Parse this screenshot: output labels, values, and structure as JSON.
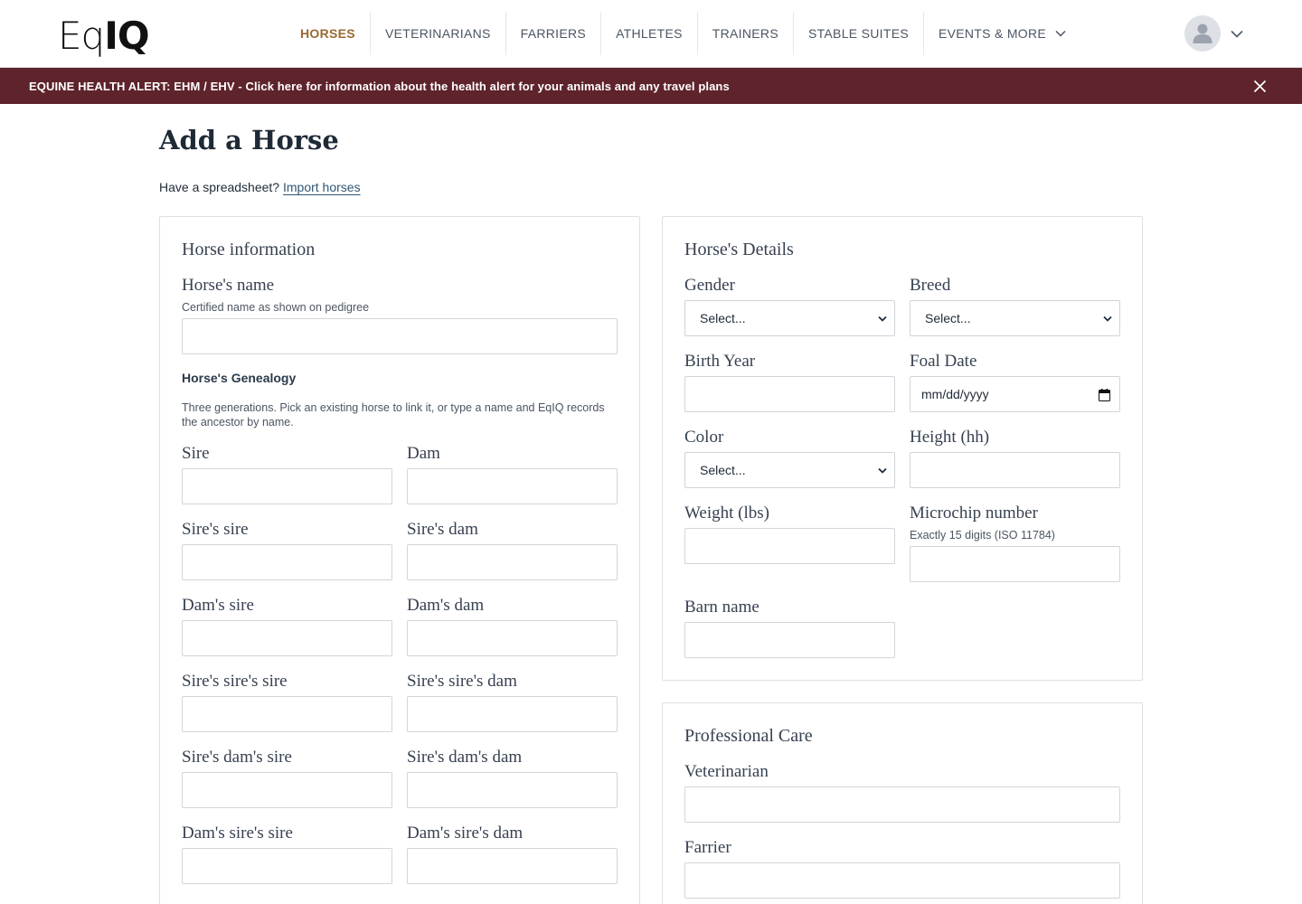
{
  "brand": {
    "logo_light": "Eq",
    "logo_bold": "IQ"
  },
  "nav": {
    "items": [
      {
        "label": "HORSES",
        "active": true
      },
      {
        "label": "VETERINARIANS"
      },
      {
        "label": "FARRIERS"
      },
      {
        "label": "ATHLETES"
      },
      {
        "label": "TRAINERS"
      },
      {
        "label": "STABLE SUITES"
      },
      {
        "label": "EVENTS & MORE",
        "dropdown": true
      }
    ]
  },
  "alert": {
    "text": "EQUINE HEALTH ALERT: EHM / EHV - Click here for information about the health alert for your animals and any travel plans"
  },
  "page": {
    "title": "Add a Horse",
    "import_prefix": "Have a spreadsheet? ",
    "import_link": "Import horses"
  },
  "horse_info": {
    "title": "Horse information",
    "name_label": "Horse's name",
    "name_hint": "Certified name as shown on pedigree",
    "genealogy_heading": "Horse's Genealogy",
    "genealogy_desc": "Three generations. Pick an existing horse to link it, or type a name and EqIQ records the ancestor by name.",
    "fields": [
      {
        "label": "Sire"
      },
      {
        "label": "Dam"
      },
      {
        "label": "Sire's sire"
      },
      {
        "label": "Sire's dam"
      },
      {
        "label": "Dam's sire"
      },
      {
        "label": "Dam's dam"
      },
      {
        "label": "Sire's sire's sire"
      },
      {
        "label": "Sire's sire's dam"
      },
      {
        "label": "Sire's dam's sire"
      },
      {
        "label": "Sire's dam's dam"
      },
      {
        "label": "Dam's sire's sire"
      },
      {
        "label": "Dam's sire's dam"
      }
    ]
  },
  "details": {
    "title": "Horse's Details",
    "gender_label": "Gender",
    "gender_value": "Select...",
    "breed_label": "Breed",
    "breed_value": "Select...",
    "birth_year_label": "Birth Year",
    "foal_date_label": "Foal Date",
    "foal_date_placeholder": "mm/dd/yyyy",
    "color_label": "Color",
    "color_value": "Select...",
    "height_label": "Height (hh)",
    "weight_label": "Weight (lbs)",
    "microchip_label": "Microchip number",
    "microchip_hint": "Exactly 15 digits (ISO 11784)",
    "barn_label": "Barn name"
  },
  "care": {
    "title": "Professional Care",
    "vet_label": "Veterinarian",
    "farrier_label": "Farrier"
  },
  "colors": {
    "accent": "#9a6a32",
    "alert_bg": "#5e232b",
    "link": "#2f5675"
  }
}
